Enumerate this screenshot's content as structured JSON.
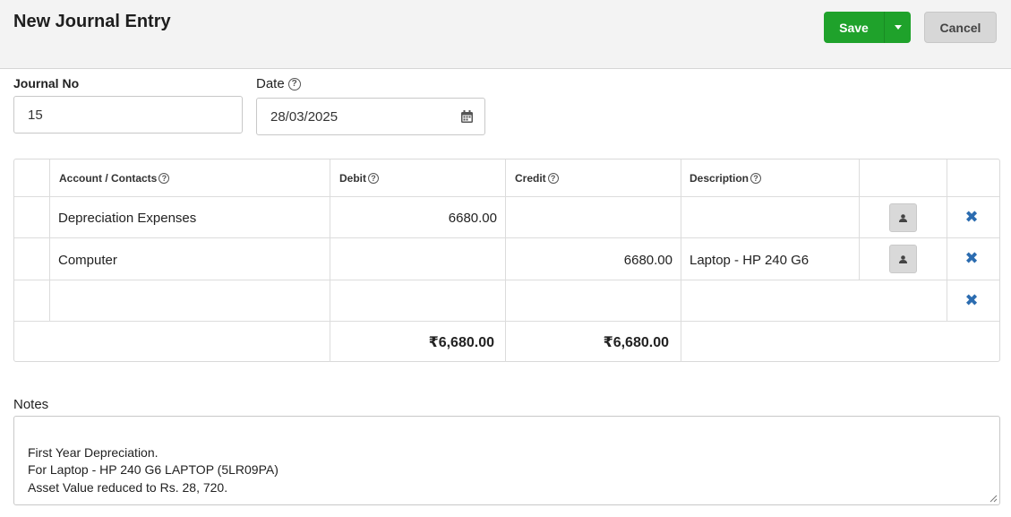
{
  "header": {
    "title": "New Journal Entry",
    "save_label": "Save",
    "cancel_label": "Cancel"
  },
  "form": {
    "journal_no_label": "Journal No",
    "journal_no_value": "15",
    "date_label": "Date",
    "date_value": "28/03/2025"
  },
  "table": {
    "columns": {
      "account": "Account / Contacts",
      "debit": "Debit",
      "credit": "Credit",
      "description": "Description"
    },
    "rows": [
      {
        "account": "Depreciation Expenses",
        "debit": "6680.00",
        "credit": "",
        "description": ""
      },
      {
        "account": "Computer",
        "debit": "",
        "credit": "6680.00",
        "description": "Laptop - HP 240 G6"
      },
      {
        "account": "",
        "debit": "",
        "credit": "",
        "description": ""
      }
    ],
    "totals": {
      "debit": "₹6,680.00",
      "credit": "₹6,680.00"
    }
  },
  "notes": {
    "label": "Notes",
    "value": "First Year Depreciation.\nFor Laptop - HP 240 G6 LAPTOP (5LR09PA)\nAsset Value reduced to Rs. 28, 720."
  },
  "icons": {
    "help": "question-circle-icon",
    "calendar": "calendar-icon",
    "contact": "user-icon",
    "remove": "close-x-icon",
    "dropdown": "caret-down-icon"
  },
  "colors": {
    "save": "#1fa22b",
    "cancel": "#d7d7d7",
    "remove_icon": "#2b6cb0",
    "header_bg": "#f3f3f3"
  }
}
